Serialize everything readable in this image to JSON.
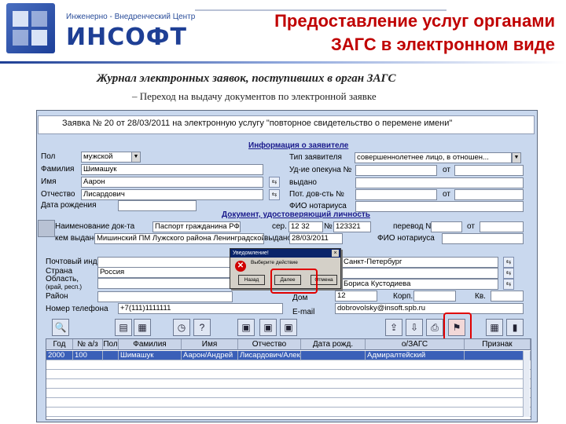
{
  "slide": {
    "logo_small": "Инженерно - Внедренческий Центр",
    "logo_big": "ИНСОФТ",
    "title_line1": "Предоставление услуг органами",
    "title_line2": "ЗАГС в электронном виде",
    "subtitle": "Журнал электронных заявок, поступивших в орган ЗАГС",
    "subtitle2": "– Переход на выдачу документов по электронной заявке"
  },
  "app": {
    "header": "Заявка № 20 от 28/03/2011 на электронную услугу \"повторное свидетельство о перемене имени\"",
    "section_applicant": "Информация о заявителе",
    "section_doc": "Документ, удостоверяющий личность",
    "labels": {
      "pol": "Пол",
      "familiya": "Фамилия",
      "imya": "Имя",
      "otchestvo": "Отчество",
      "data_rozhd": "Дата рождения",
      "tip_zayavitelya": "Тип заявителя",
      "ud_opekuna": "Уд-ие опекуна №",
      "vydano": "выдано",
      "pot_dov": "Пот. дов-сть №",
      "fio_notariusa": "ФИО нотариуса",
      "naim_doc": "Наименование док-та",
      "ser": "сер.",
      "num": "№",
      "perevod": "перевод №",
      "ot": "от",
      "kem_vydan": "кем выдано",
      "vydano2": "выдано",
      "fio_not2": "ФИО нотариуса",
      "pocht_index": "Почтовый индекс",
      "strana": "Страна",
      "oblast": "Область,",
      "oblast2": "(край, респ.)",
      "rayon": "Район",
      "dom": "Дом",
      "korp": "Корп.",
      "kv": "Кв.",
      "phone": "Номер телефона",
      "email": "E-mail"
    },
    "values": {
      "pol": "мужской",
      "familiya": "Шимашук",
      "imya": "Аарон",
      "otchestvo": "Лисардович",
      "tip_zayavitelya": "совершеннолетнее лицо, в отношен...",
      "naim_doc": "Паспорт гражданина РФ",
      "ser": "12 32",
      "num": "123321",
      "kem_vydan": "Мишинский ПМ Лужского района Ленинградской",
      "vydano2": "28/03/2011",
      "strana": "Россия",
      "city": "Санкт-Петербург",
      "street": "Бориса Кустодиева",
      "dom": "12",
      "phone": "+7(111)1111111",
      "email": "dobrovolsky@insoft.spb.ru"
    }
  },
  "dialog": {
    "title": "Уведомление!",
    "message": "Выберите действие",
    "btn_back": "Назад",
    "btn_yes": "Далее",
    "btn_cancel": "Отмена"
  },
  "table": {
    "columns": [
      "Год",
      "№ а/з",
      "Пол",
      "Фамилия",
      "Имя",
      "Отчество",
      "Дата рожд.",
      "о/ЗАГС",
      "Признак"
    ],
    "rows": [
      [
        "2000",
        "100",
        "",
        "Шимашук",
        "Аарон/Андрей",
        "Лисардович/Алек",
        "",
        "Адмиралтейский",
        ""
      ]
    ]
  },
  "colors": {
    "accent_red": "#c00000",
    "selection_blue": "#3a5fb8",
    "logo_blue": "#1e3f95"
  }
}
